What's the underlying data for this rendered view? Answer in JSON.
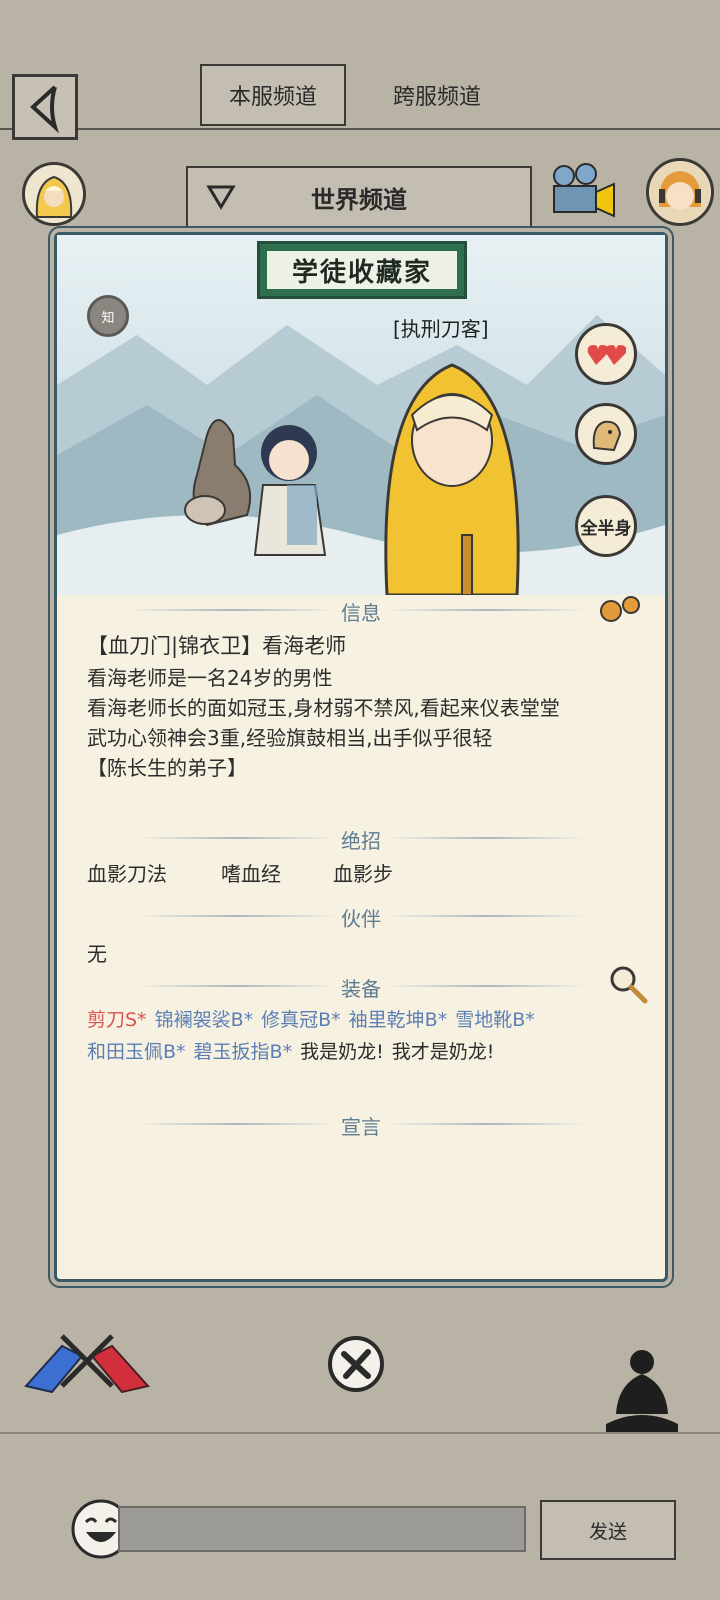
{
  "header": {
    "tabs": [
      {
        "label": "本服频道",
        "active": true
      },
      {
        "label": "跨服频道",
        "active": false
      }
    ]
  },
  "channel": {
    "selected": "世界频道"
  },
  "card": {
    "title": "学徒收藏家",
    "role": "[执刑刀客]",
    "know_badge": "知",
    "side_buttons": [
      "",
      "",
      "全半身"
    ],
    "sections": {
      "info": {
        "title": "信息",
        "lines": [
          "【血刀门|锦衣卫】看海老师",
          "看海老师是一名24岁的男性",
          "看海老师长的面如冠玉,身材弱不禁风,看起来仪表堂堂",
          "武功心领神会3重,经验旗鼓相当,出手似乎很轻",
          "【陈长生的弟子】"
        ]
      },
      "skills": {
        "title": "绝招",
        "items": [
          "血影刀法",
          "嗜血经",
          "血影步"
        ]
      },
      "partner": {
        "title": "伙伴",
        "value": "无"
      },
      "equipment": {
        "title": "装备",
        "row1": [
          {
            "name": "剪刀S*",
            "color": "#d9534f"
          },
          {
            "name": "锦襕袈裟B*",
            "color": "#5b7fb5"
          },
          {
            "name": "修真冠B*",
            "color": "#5b7fb5"
          },
          {
            "name": "袖里乾坤B*",
            "color": "#5b7fb5"
          },
          {
            "name": "雪地靴B*",
            "color": "#5b7fb5"
          }
        ],
        "row2": [
          {
            "name": "和田玉佩B*",
            "color": "#5b7fb5"
          },
          {
            "name": "碧玉扳指B*",
            "color": "#5b7fb5"
          },
          {
            "name": "我是奶龙!",
            "color": "#2d2d2d"
          },
          {
            "name": "我才是奶龙!",
            "color": "#2d2d2d"
          }
        ]
      },
      "declaration": {
        "title": "宣言"
      }
    }
  },
  "footer": {
    "input_placeholder": "",
    "send_label": "发送"
  },
  "colors": {
    "background": "#b9b3a5",
    "card_border": "#3c5a66",
    "section_title": "#5e7d91",
    "title_plate": "#2f6e4e"
  }
}
